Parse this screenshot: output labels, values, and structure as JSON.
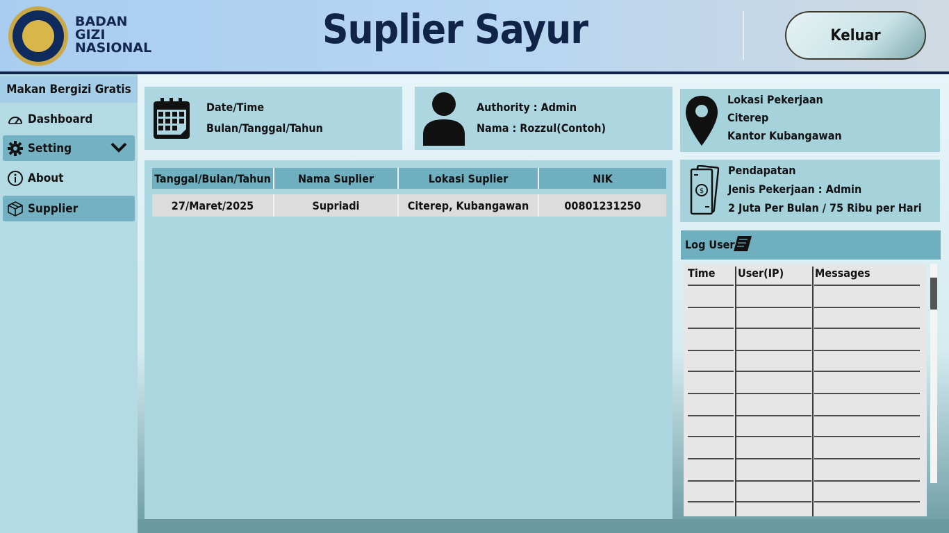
{
  "header": {
    "brand_line1": "BADAN",
    "brand_line2": "GIZI",
    "brand_line3": "NASIONAL",
    "title": "Suplier Sayur",
    "logout_label": "Keluar"
  },
  "sidebar": {
    "heading": "Makan Bergizi Gratis",
    "items": [
      {
        "label": "Dashboard",
        "icon": "gauge-icon"
      },
      {
        "label": "Setting",
        "icon": "gear-icon"
      },
      {
        "label": "About",
        "icon": "info-icon"
      },
      {
        "label": "Supplier",
        "icon": "box-icon"
      }
    ]
  },
  "info_cards": {
    "datetime": {
      "line1": "Date/Time",
      "line2": "Bulan/Tanggal/Tahun",
      "icon": "calendar-icon"
    },
    "user": {
      "authority": "Authority : Admin",
      "name": "Nama : Rozzul(Contoh)",
      "icon": "user-icon"
    },
    "location": {
      "title": "Lokasi Pekerjaan",
      "line1": "Citerep",
      "line2": "Kantor Kubangawan",
      "icon": "location-pin-icon"
    },
    "income": {
      "title": "Pendapatan",
      "line1": "Jenis Pekerjaan : Admin",
      "line2": "2 Juta Per Bulan / 75 Ribu per Hari",
      "icon": "money-icon"
    }
  },
  "table": {
    "headers": [
      "Tanggal/Bulan/Tahun",
      "Nama Suplier",
      "Lokasi Suplier",
      "NIK"
    ],
    "rows": [
      [
        "27/Maret/2025",
        "Supriadi",
        "Citerep, Kubangawan",
        "00801231250"
      ]
    ]
  },
  "log": {
    "title": "Log User",
    "columns": [
      "Time",
      "User(IP)",
      "Messages"
    ]
  },
  "colors": {
    "header_dark": "#0f2447",
    "accent": "#6fafc0",
    "panel": "#add6e0"
  }
}
